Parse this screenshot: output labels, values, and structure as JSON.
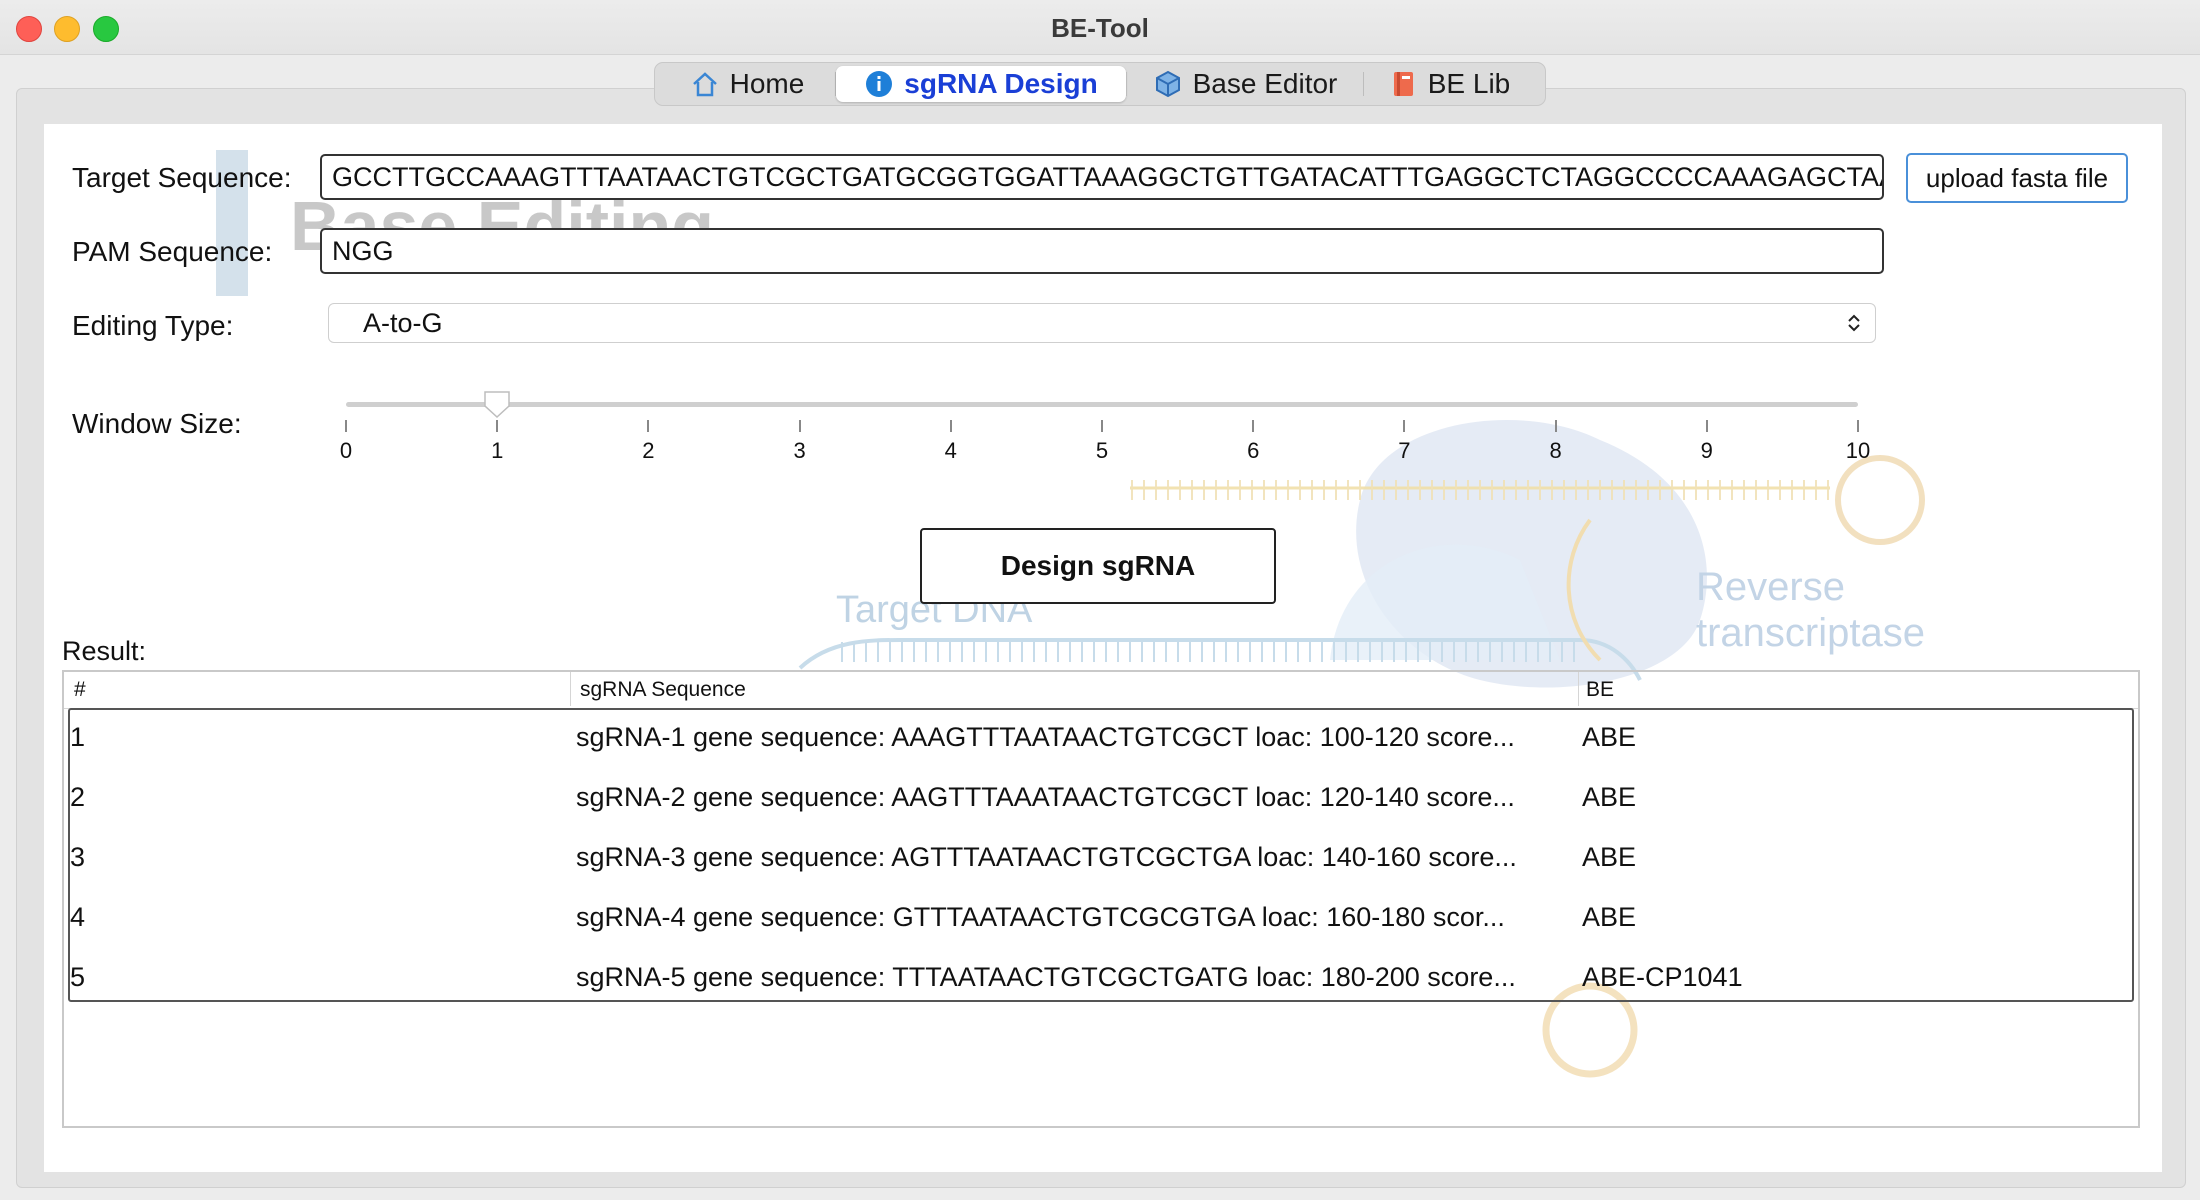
{
  "window": {
    "title": "BE-Tool"
  },
  "tabs": [
    {
      "label": "Home",
      "icon": "home-icon",
      "active": false
    },
    {
      "label": "sgRNA Design",
      "icon": "info-icon",
      "active": true
    },
    {
      "label": "Base Editor",
      "icon": "cube-icon",
      "active": false
    },
    {
      "label": "BE Lib",
      "icon": "book-icon",
      "active": false
    }
  ],
  "form": {
    "target_label": "Target Sequence:",
    "target_value": "GCCTTGCCAAAGTTTAATAACTGTCGCTGATGCGGTGGATTAAAGGCTGTTGATACATTTGAGGCTCTAGGCCCCAAAGAGCTAAGCG",
    "upload_label": "upload fasta file",
    "pam_label": "PAM Sequence:",
    "pam_value": "NGG",
    "editing_label": "Editing Type:",
    "editing_value": "A-to-G",
    "window_label": "Window Size:",
    "window_value": 1,
    "window_ticks": [
      "0",
      "1",
      "2",
      "3",
      "4",
      "5",
      "6",
      "7",
      "8",
      "9",
      "10"
    ],
    "design_button": "Design sgRNA"
  },
  "background_art": {
    "title_text": "Base Editing",
    "target_dna": "Target DNA",
    "reverse_1": "Reverse",
    "reverse_2": "transcriptase"
  },
  "result": {
    "label": "Result:",
    "columns": [
      "#",
      "sgRNA Sequence",
      "BE"
    ],
    "rows": [
      {
        "num": "1",
        "seq": "sgRNA-1 gene sequence: AAAGTTTAATAACTGTCGCT loac: 100-120 score...",
        "be": "ABE"
      },
      {
        "num": "2",
        "seq": "sgRNA-2 gene sequence: AAGTTTAAATAACTGTCGCT loac: 120-140 score...",
        "be": "ABE"
      },
      {
        "num": "3",
        "seq": "sgRNA-3 gene sequence: AGTTTAATAACTGTCGCTGA loac: 140-160 score...",
        "be": "ABE"
      },
      {
        "num": "4",
        "seq": "sgRNA-4 gene sequence: GTTTAATAACTGTCGCGTGA loac: 160-180 scor...",
        "be": "ABE"
      },
      {
        "num": "5",
        "seq": "sgRNA-5 gene sequence: TTTAATAACTGTCGCTGATG loac: 180-200 score...",
        "be": "ABE-CP1041"
      }
    ]
  }
}
